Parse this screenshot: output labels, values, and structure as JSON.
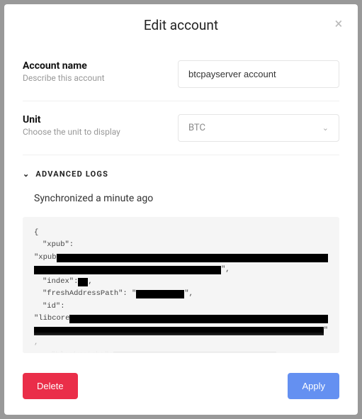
{
  "header": {
    "title": "Edit account"
  },
  "form": {
    "accountName": {
      "label": "Account name",
      "hint": "Describe this account",
      "value": "btcpayserver account"
    },
    "unit": {
      "label": "Unit",
      "hint": "Choose the unit to display",
      "value": "BTC"
    }
  },
  "advanced": {
    "title": "Advanced Logs",
    "syncLabel": "Synchronized a minute ago",
    "log": {
      "line1": "{",
      "line2_pre": "\"xpub\":",
      "line3_pre": "\"xpub",
      "line4_suf": "\",",
      "line5_pre": "\"index\": ",
      "line5_suf": ",",
      "line6_pre": "\"freshAddressPath\": \"",
      "line6_suf": "\",",
      "line7_pre": "\"id\":",
      "line8_pre": "\"libcore",
      "line9_suf": "\"",
      "line10": ",",
      "line11_pre": "\"blockHeight\": "
    }
  },
  "footer": {
    "deleteLabel": "Delete",
    "applyLabel": "Apply"
  }
}
